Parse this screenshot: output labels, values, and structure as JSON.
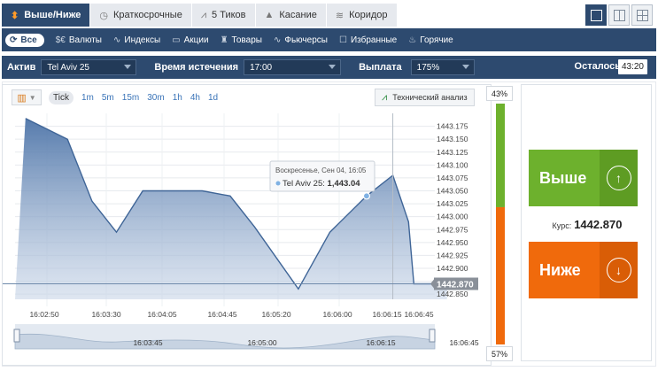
{
  "top_tabs": [
    {
      "label": "Выше/Ниже",
      "icon": "updown-icon",
      "active": true
    },
    {
      "label": "Краткосрочные",
      "icon": "stopwatch-icon",
      "active": false
    },
    {
      "label": "5 Тиков",
      "icon": "ticks-icon",
      "active": false
    },
    {
      "label": "Касание",
      "icon": "touch-icon",
      "active": false
    },
    {
      "label": "Коридор",
      "icon": "corridor-icon",
      "active": false
    }
  ],
  "categories": [
    {
      "label": "Все",
      "icon": "refresh-icon",
      "active": true
    },
    {
      "label": "Валюты",
      "icon": "currency-icon"
    },
    {
      "label": "Индексы",
      "icon": "index-icon"
    },
    {
      "label": "Акции",
      "icon": "stocks-icon"
    },
    {
      "label": "Товары",
      "icon": "commodities-icon"
    },
    {
      "label": "Фьючерсы",
      "icon": "futures-icon"
    },
    {
      "label": "Избранные",
      "icon": "favorites-icon"
    },
    {
      "label": "Горячие",
      "icon": "fire-icon"
    }
  ],
  "params": {
    "asset_label": "Актив",
    "asset_value": "Tel Aviv 25",
    "expiry_label": "Время истечения",
    "expiry_value": "17:00",
    "payout_label": "Выплата",
    "payout_value": "175%",
    "remaining_label": "Осталось",
    "remaining_value": "43:20"
  },
  "chart_toolbar": {
    "timeframes": [
      "Tick",
      "1m",
      "5m",
      "15m",
      "30m",
      "1h",
      "4h",
      "1d"
    ],
    "active": "Tick",
    "tech_analysis_label": "Технический анализ"
  },
  "tooltip": {
    "date": "Воскресенье, Сен 04, 16:05",
    "series": "Tel Aviv 25:",
    "value": "1,443.04"
  },
  "current_price_label": "1442.870",
  "sentiment": {
    "top_pct": "43%",
    "bottom_pct": "57%",
    "top_color": "#6db12d",
    "bottom_color": "#f06a0c"
  },
  "trade": {
    "up_label": "Выше",
    "down_label": "Ниже",
    "rate_label": "Курс:",
    "rate_value": "1442.870",
    "up_color": "#6db12d",
    "down_color": "#f06a0c"
  },
  "chart_data": {
    "type": "area",
    "series": [
      {
        "name": "Tel Aviv 25",
        "x": [
          "16:02:38",
          "16:03:02",
          "16:03:16",
          "16:03:30",
          "16:03:45",
          "16:04:19",
          "16:04:35",
          "16:04:49",
          "16:05:14",
          "16:05:32",
          "16:05:53",
          "16:06:08",
          "16:06:17",
          "16:06:20",
          "16:06:39"
        ],
        "values": [
          1443.19,
          1443.15,
          1443.03,
          1442.97,
          1443.05,
          1443.05,
          1443.04,
          1442.98,
          1442.86,
          1442.97,
          1443.04,
          1443.08,
          1442.99,
          1442.87,
          1442.87
        ]
      }
    ],
    "y_ticks": [
      "1443.175",
      "1443.150",
      "1443.125",
      "1443.100",
      "1443.075",
      "1443.050",
      "1443.025",
      "1443.000",
      "1442.975",
      "1442.950",
      "1442.925",
      "1442.900",
      "1442.875",
      "1442.850"
    ],
    "x_ticks": [
      "16:02:50",
      "16:03:30",
      "16:04:05",
      "16:04:45",
      "16:05:20",
      "16:06:00",
      "16:06:15",
      "16:06:45"
    ],
    "navigator_ticks": [
      "16:03:45",
      "16:05:00",
      "16:06:15",
      "16:06:45"
    ],
    "ylim": [
      1442.84,
      1443.2
    ],
    "grid": true
  }
}
